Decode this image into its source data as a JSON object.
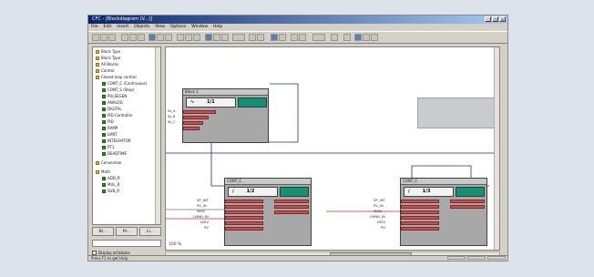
{
  "window": {
    "title": "CFC - [Blockdiagram (V...)]",
    "controls": [
      "_",
      "□",
      "x"
    ]
  },
  "menubar": [
    "File",
    "Edit",
    "Insert",
    "Objects",
    "View",
    "Options",
    "Window",
    "Help"
  ],
  "tree": {
    "items": [
      {
        "label": "Block Type",
        "level": 1,
        "folder": true
      },
      {
        "label": "Block Type",
        "level": 1,
        "folder": true
      },
      {
        "label": "All Blocks",
        "level": 1,
        "folder": true
      },
      {
        "label": "Control",
        "level": 1,
        "folder": true
      },
      {
        "label": "Closed-loop control",
        "level": 1,
        "folder": true
      },
      {
        "label": "CONT_C (Continuous)",
        "level": 2,
        "folder": false
      },
      {
        "label": "CONT_S (Step)",
        "level": 2,
        "folder": false
      },
      {
        "label": "PULSEGEN",
        "level": 2,
        "folder": false
      },
      {
        "label": "ANALOG",
        "level": 2,
        "folder": false
      },
      {
        "label": "DIGITAL",
        "level": 2,
        "folder": false
      },
      {
        "label": "PID Controller",
        "level": 2,
        "folder": false
      },
      {
        "label": "PID",
        "level": 2,
        "folder": false
      },
      {
        "label": "RAMP",
        "level": 2,
        "folder": false
      },
      {
        "label": "LIMIT",
        "level": 2,
        "folder": false
      },
      {
        "label": "INTEGRATOR",
        "level": 2,
        "folder": false
      },
      {
        "label": "PT1",
        "level": 2,
        "folder": false
      },
      {
        "label": "DEADTIME",
        "level": 2,
        "folder": false
      },
      {
        "label": "Conversion",
        "level": 1,
        "folder": true
      },
      {
        "label": "Math",
        "level": 1,
        "folder": true
      },
      {
        "label": "ADD_R",
        "level": 2,
        "folder": false
      },
      {
        "label": "MUL_R",
        "level": 2,
        "folder": false
      },
      {
        "label": "SUB_R",
        "level": 2,
        "folder": false
      }
    ]
  },
  "tabs": [
    "Bl...",
    "Pr...",
    "Li..."
  ],
  "checkbox_label": "Display all blocks",
  "canvas": {
    "blocks": [
      {
        "name": "block-top",
        "header": "Block 1",
        "symbol": "∿",
        "title": "1/1"
      },
      {
        "name": "block-mid",
        "header": "CONT_C",
        "symbol": "∕",
        "title": "1/2"
      },
      {
        "name": "block-right",
        "header": "CONT_C",
        "symbol": "∕",
        "title": "1/3"
      }
    ],
    "inputs_left": [
      "IN_A",
      "IN_B",
      "IN_C"
    ],
    "inputs_mid": [
      "SP_INT",
      "PV_IN",
      "MAN",
      "LMNR_IN",
      "DISV",
      "PV"
    ],
    "inputs_right": [
      "SP_INT",
      "PV_IN",
      "MAN",
      "LMNR_IN",
      "DISV",
      "PV"
    ],
    "zoom_text": "100 %"
  },
  "status": "Press F1 to get Help.",
  "colors": {
    "block_green": "#1a8e72",
    "pin_red": "#c85050",
    "wire_blue": "#1f2e8a"
  }
}
